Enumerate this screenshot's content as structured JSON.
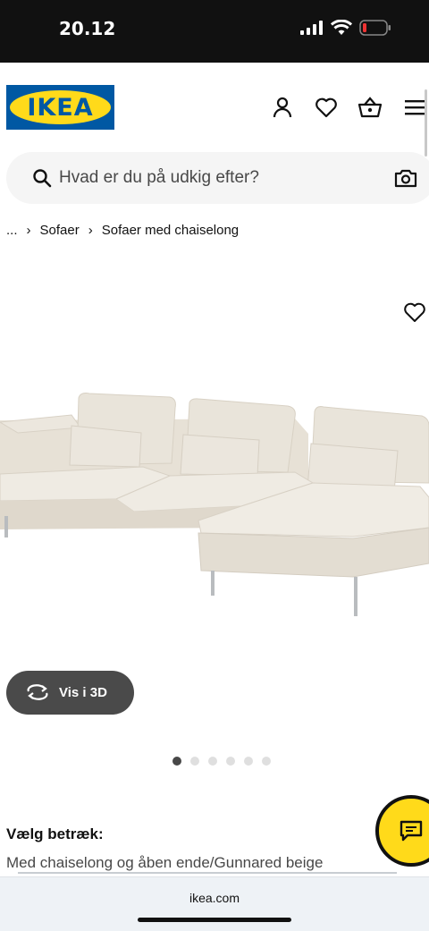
{
  "status_bar": {
    "time": "20.12"
  },
  "header": {
    "logo_text": "IKEA",
    "icons": [
      "profile-icon",
      "heart-icon",
      "basket-icon",
      "menu-icon"
    ]
  },
  "search": {
    "placeholder": "Hvad er du på udkig efter?"
  },
  "breadcrumb": {
    "items": [
      "...",
      "Sofaer",
      "Sofaer med chaiselong"
    ]
  },
  "product": {
    "view_3d_label": "Vis i 3D",
    "image_count": 6,
    "active_image_index": 0,
    "variant_label": "Vælg betræk:",
    "variant_value": "Med chaiselong og åben ende/Gunnared beige"
  },
  "browser": {
    "url": "ikea.com"
  },
  "colors": {
    "ikea_blue": "#0058a3",
    "ikea_yellow": "#ffda1a"
  }
}
